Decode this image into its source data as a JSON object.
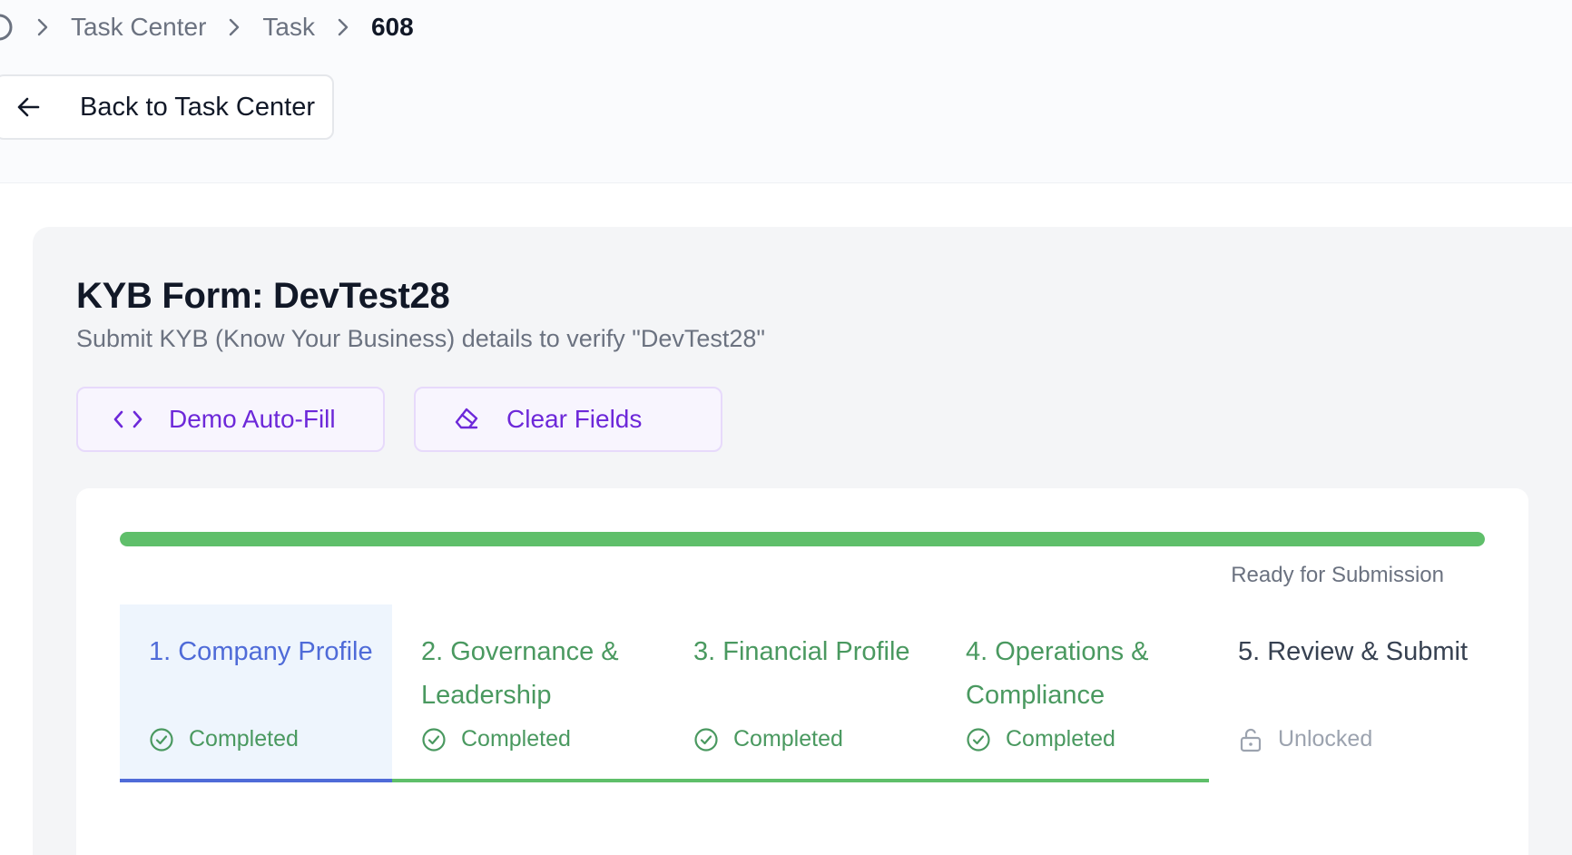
{
  "breadcrumb": {
    "items": [
      "Task Center",
      "Task",
      "608"
    ]
  },
  "back_button": {
    "label": "Back to Task Center"
  },
  "form": {
    "title": "KYB Form: DevTest28",
    "subtitle": "Submit KYB (Know Your Business) details to verify \"DevTest28\""
  },
  "actions": {
    "autofill_label": "Demo Auto-Fill",
    "clear_label": "Clear Fields"
  },
  "progress": {
    "percent": 100,
    "status": "Ready for Submission"
  },
  "steps": [
    {
      "label": "1. Company Profile",
      "state": "Completed"
    },
    {
      "label": "2. Governance & Leadership",
      "state": "Completed"
    },
    {
      "label": "3. Financial Profile",
      "state": "Completed"
    },
    {
      "label": "4. Operations & Compliance",
      "state": "Completed"
    },
    {
      "label": "5. Review & Submit",
      "state": "Unlocked"
    }
  ],
  "colors": {
    "accent_purple": "#6d28d9",
    "success_green": "#5fbf6a",
    "active_blue": "#4f6bd8"
  }
}
